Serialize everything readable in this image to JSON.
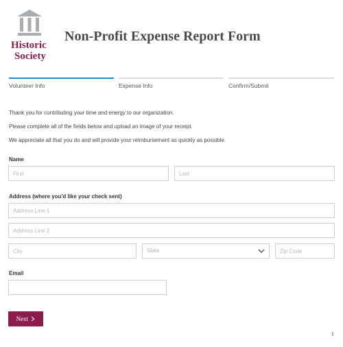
{
  "logo": {
    "line1": "Historic",
    "line2": "Society",
    "icon": "pillar-building-icon",
    "brand_color": "#8c1c4d"
  },
  "page_title": "Non-Profit Expense Report Form",
  "steps": [
    {
      "label": "Volunteer Info",
      "active": true
    },
    {
      "label": "Expense Info",
      "active": false
    },
    {
      "label": "Confirm/Submit",
      "active": false
    }
  ],
  "intro": [
    "Thank you for contributing your time and energy to our organization.",
    "Please complete all of the fields below and upload an image of your receipt.",
    "We appreciate all that you do and will provide your reimbursement as quickly as possible."
  ],
  "name_section": {
    "label": "Name",
    "first_placeholder": "First",
    "last_placeholder": "Last"
  },
  "address_section": {
    "label": "Address (where you'd like your check sent)",
    "line1_placeholder": "Address Line 1",
    "line2_placeholder": "Address Line 2",
    "city_placeholder": "City",
    "state_placeholder": "State",
    "zip_placeholder": "Zip Code"
  },
  "email_section": {
    "label": "Email",
    "value": ""
  },
  "next_button": {
    "label": "Next",
    "icon": "chevron-right-icon"
  },
  "page_number": "1",
  "colors": {
    "accent": "#1a8fd1",
    "button": "#8c1c4d"
  }
}
